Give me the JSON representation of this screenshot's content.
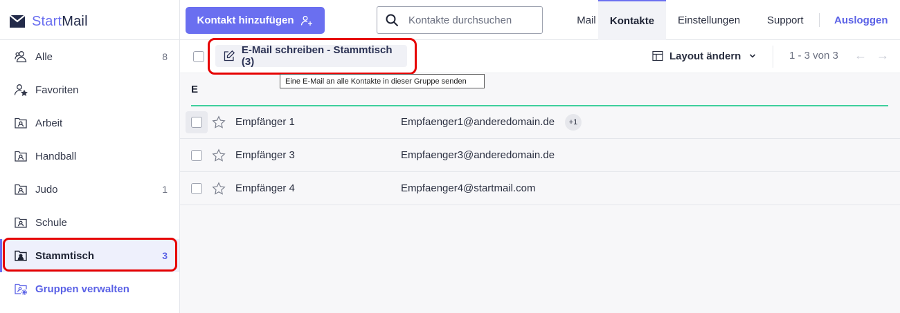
{
  "app": {
    "logo_start": "Start",
    "logo_mail": "Mail",
    "accent": "#6a6ff0"
  },
  "sidebar": {
    "items": [
      {
        "label": "Alle",
        "count": "8",
        "icon": "users-icon"
      },
      {
        "label": "Favoriten",
        "count": "",
        "icon": "user-star-icon"
      },
      {
        "label": "Arbeit",
        "count": "",
        "icon": "contact-folder-icon"
      },
      {
        "label": "Handball",
        "count": "",
        "icon": "contact-folder-icon"
      },
      {
        "label": "Judo",
        "count": "1",
        "icon": "contact-folder-icon"
      },
      {
        "label": "Schule",
        "count": "",
        "icon": "contact-folder-icon"
      },
      {
        "label": "Stammtisch",
        "count": "3",
        "icon": "contact-folder-filled-icon"
      }
    ],
    "manage_label": "Gruppen verwalten"
  },
  "topbar": {
    "add_contact_label": "Kontakt hinzufügen",
    "search_placeholder": "Kontakte durchsuchen",
    "nav": {
      "mail": "Mail",
      "contacts": "Kontakte",
      "settings": "Einstellungen",
      "support": "Support",
      "logout": "Ausloggen"
    }
  },
  "toolbar": {
    "email_group_label": "E-Mail schreiben - Stammtisch (3)",
    "tooltip": "Eine E-Mail an alle Kontakte in dieser Gruppe senden",
    "layout_label": "Layout ändern",
    "paging": "1 - 3 von 3"
  },
  "contacts": {
    "group_letter": "E",
    "rows": [
      {
        "name": "Empfänger 1",
        "email": "Empfaenger1@anderedomain.de",
        "extra": "+1"
      },
      {
        "name": "Empfänger 3",
        "email": "Empfaenger3@anderedomain.de",
        "extra": ""
      },
      {
        "name": "Empfänger 4",
        "email": "Empfaenger4@startmail.com",
        "extra": ""
      }
    ]
  }
}
